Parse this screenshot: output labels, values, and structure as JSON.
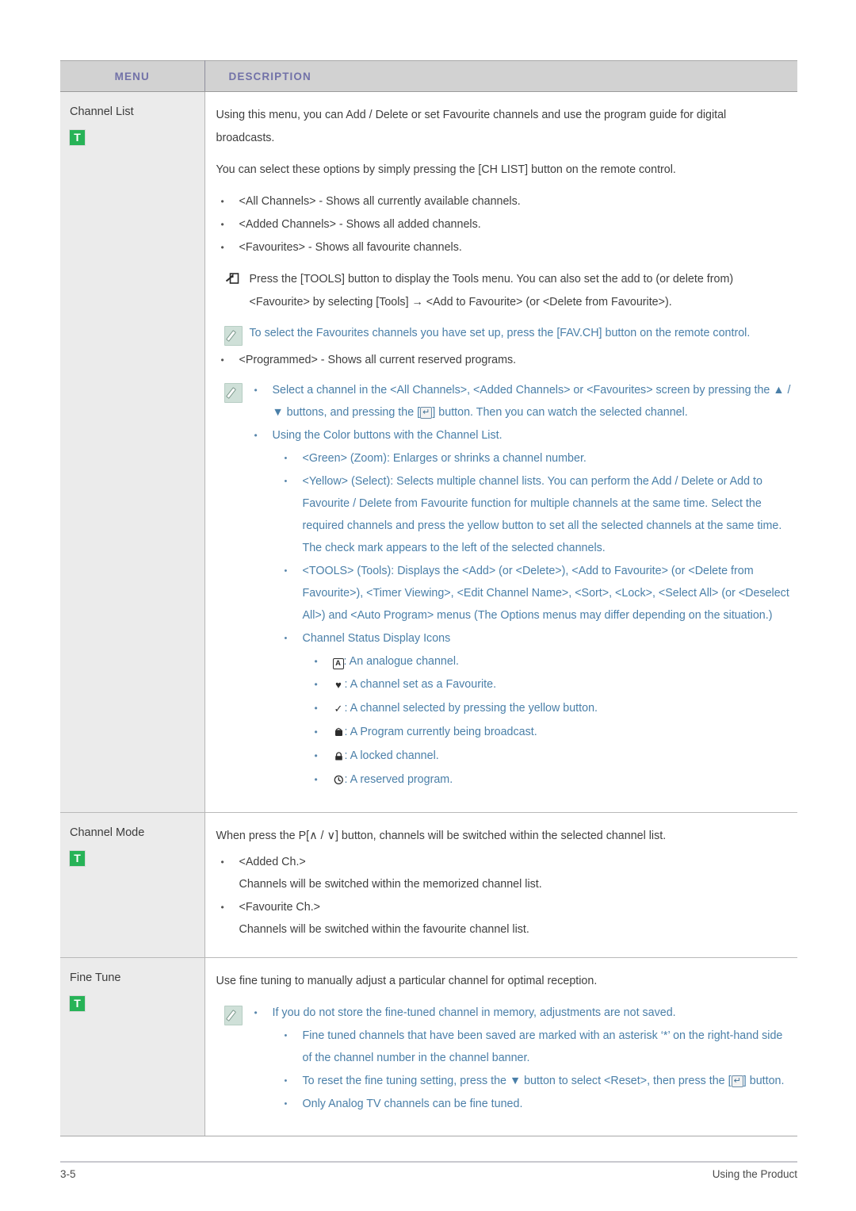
{
  "header": {
    "menu_label": "MENU",
    "description_label": "DESCRIPTION"
  },
  "colors": {
    "header_bg": "#d2d2d2",
    "header_text": "#7272a8",
    "menu_cell_bg": "#ebebeb",
    "note_text": "#4a7fa8",
    "badge_green": "#27b357",
    "body_text": "#3f3f3f"
  },
  "rows": [
    {
      "menu": {
        "title": "Channel List",
        "badge": "T"
      },
      "desc": {
        "p1": "Using this menu, you can Add / Delete or set Favourite channels and use the program guide for digital broadcasts.",
        "p2": "You can select these options by simply pressing the [CH LIST] button on the remote control.",
        "bullets_top": [
          "<All Channels> - Shows all currently available channels.",
          "<Added Channels> - Shows all added channels.",
          "<Favourites> - Shows all favourite channels."
        ],
        "tools_note": "Press the [TOOLS] button to display the Tools menu. You can also set the add to (or delete from) <Favourite> by selecting [Tools] → <Add to Favourite> (or <Delete from Favourite>).",
        "note_fav": "To select the Favourites channels you have set up, press the [FAV.CH] button on the remote control.",
        "bullet_programmed": "<Programmed> - Shows all current reserved programs.",
        "note_select_pre": "Select a channel in the <All Channels>, <Added Channels> or <Favourites> screen by pressing the ▲ / ▼ buttons, and pressing the [",
        "note_select_post": "] button. Then you can watch the selected channel.",
        "note_color_heading": "Using the Color buttons with the Channel List.",
        "note_color_items": [
          "<Green> (Zoom): Enlarges or shrinks a channel number.",
          "<Yellow> (Select): Selects multiple channel lists. You can perform the Add / Delete or Add to Favourite / Delete from Favourite function for multiple channels at the same time. Select the required channels and press the yellow button to set all the selected channels at the same time. The check mark appears to the left of the selected channels.",
          "<TOOLS> (Tools): Displays the <Add> (or <Delete>), <Add to Favourite> (or <Delete from Favourite>), <Timer Viewing>, <Edit Channel Name>, <Sort>, <Lock>, <Select All> (or <Deselect All>) and <Auto Program> menus (The Options menus may differ depending on the situation.)"
        ],
        "status_heading": "Channel Status Display Icons",
        "status_items": [
          {
            "icon": "analogue-channel-icon",
            "glyph": "A",
            "text": ": An analogue channel."
          },
          {
            "icon": "favourite-heart-icon",
            "glyph": "♥",
            "text": ": A channel set as a Favourite."
          },
          {
            "icon": "check-mark-icon",
            "glyph": "✔",
            "text": ": A channel selected by pressing the yellow button."
          },
          {
            "icon": "tv-broadcast-icon",
            "glyph": "📺",
            "text": ": A Program currently being broadcast."
          },
          {
            "icon": "lock-icon",
            "glyph": "🔒",
            "text": ": A locked channel."
          },
          {
            "icon": "clock-icon",
            "glyph": "🕒",
            "text": ": A reserved program."
          }
        ]
      }
    },
    {
      "menu": {
        "title": "Channel Mode",
        "badge": "T"
      },
      "desc": {
        "p1_pre": "When press the P[",
        "p1_arrows": "∧ / ∨",
        "p1_post": "] button, channels will be switched within the selected channel list.",
        "items": [
          {
            "label": "<Added Ch.>",
            "detail": "Channels will be switched within the memorized channel list."
          },
          {
            "label": "<Favourite Ch.>",
            "detail": "Channels will be switched within the favourite channel list."
          }
        ]
      }
    },
    {
      "menu": {
        "title": "Fine Tune",
        "badge": "T"
      },
      "desc": {
        "p1": "Use fine tuning to manually adjust a particular channel for optimal reception.",
        "notes": [
          "If you do not store the fine-tuned channel in memory, adjustments are not saved.",
          "Fine tuned channels that have been saved are marked with an asterisk ‘*’ on the right-hand side of the channel number in the channel banner.",
          "Only Analog TV channels can be fine tuned."
        ],
        "reset_pre": "To reset the fine tuning setting, press the ▼ button to select <Reset>, then press the [",
        "reset_post": "] button."
      }
    }
  ],
  "footer": {
    "page_number": "3-5",
    "section_title": "Using the Product"
  }
}
